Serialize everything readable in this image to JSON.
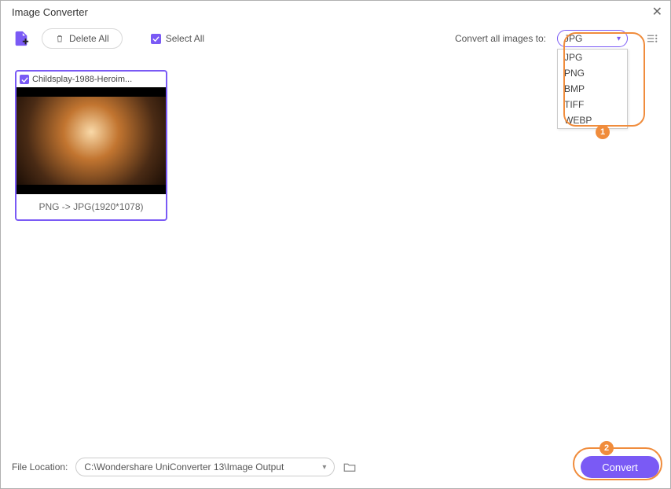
{
  "window": {
    "title": "Image Converter"
  },
  "toolbar": {
    "delete_all": "Delete All",
    "select_all": "Select All",
    "convert_label": "Convert all images to:"
  },
  "format": {
    "selected": "JPG",
    "options": [
      "JPG",
      "PNG",
      "BMP",
      "TIFF",
      "WEBP"
    ]
  },
  "thumbnails": [
    {
      "name": "Childsplay-1988-Heroim...",
      "footer": "PNG -> JPG(1920*1078)"
    }
  ],
  "footer": {
    "location_label": "File Location:",
    "path": "C:\\Wondershare UniConverter 13\\Image Output",
    "convert": "Convert"
  },
  "annotations": {
    "n1": "1",
    "n2": "2"
  }
}
